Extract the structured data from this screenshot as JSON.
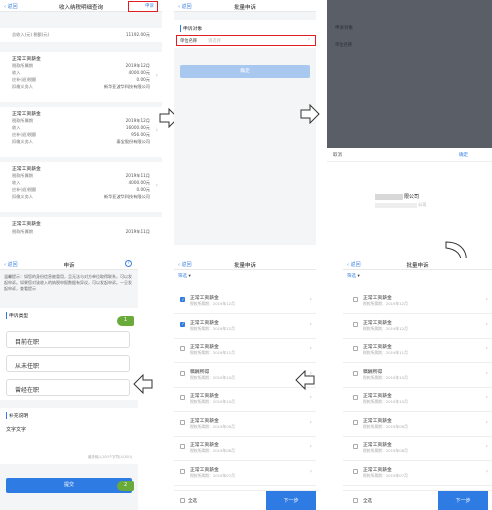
{
  "p1": {
    "back": "返回",
    "title": "收入纳税明细查询",
    "top_link": "申诉",
    "summary_k": "总收入(元) 税额(元)",
    "summary_v": "11192.00元",
    "records": [
      {
        "type": "正常工资薪金",
        "period_k": "税款所属期",
        "period_v": "2019年12月",
        "income_k": "收入",
        "income_v": "4000.00元",
        "tax_k": "应补(退)税额",
        "tax_v": "0.00元",
        "payer_k": "扣缴义务人",
        "payer_v": "新华亚波华科技有限公司"
      },
      {
        "type": "正常工资薪金",
        "period_k": "税款所属期",
        "period_v": "2019年12月",
        "income_k": "收入",
        "income_v": "16000.00元",
        "tax_k": "应补(退)税额",
        "tax_v": "956.00元",
        "payer_k": "扣缴义务人",
        "payer_v": "泰宝股份有限公司"
      },
      {
        "type": "正常工资薪金",
        "period_k": "税款所属期",
        "period_v": "2019年11月",
        "income_k": "收入",
        "income_v": "4000.00元",
        "tax_k": "应补(退)税额",
        "tax_v": "0.00元",
        "payer_k": "扣缴义务人",
        "payer_v": "新华亚波华科技有限公司"
      },
      {
        "type": "正常工资薪金",
        "period_k": "税款所属期",
        "period_v": "2019年11月"
      }
    ]
  },
  "p2": {
    "back": "返回",
    "title": "批量申诉",
    "section": "申诉对象",
    "field_k": "单位名称",
    "field_v": "请选择",
    "button": "确定"
  },
  "p3": {
    "section": "申诉对象",
    "field_k": "单位名称",
    "cancel": "取消",
    "confirm": "确定",
    "company": "限公司",
    "company_sub": "公司"
  },
  "p4": {
    "back": "返回",
    "title": "申诉",
    "help": "?",
    "notice": "温馨提示：如您的身份信息被冒用，且无法与对方单位取得联系，可以发起申诉。如果您对该收入的纳税申报数据有异议，可以发起申诉。一旦发起申诉，查看提示",
    "notice_link": "查看提示",
    "section_type": "申诉类型",
    "options": [
      "目前在职",
      "从未任职",
      "曾经在职"
    ],
    "section_extra": "补充说明",
    "extra_value": "文字文字",
    "counter": "最多输入200个字符(4/200)",
    "submit": "提交",
    "step1": "1",
    "step2": "2"
  },
  "p5": {
    "back": "返回",
    "title": "批量申诉",
    "filter": "筛选",
    "items": [
      {
        "t": "正常工资薪金",
        "s": "税款所属期：2019年12月",
        "on": true
      },
      {
        "t": "正常工资薪金",
        "s": "税款所属期：2019年12月",
        "on": true
      },
      {
        "t": "正常工资薪金",
        "s": "税款所属期：2019年11月",
        "on": false
      },
      {
        "t": "稿酬所得",
        "s": "税款所属期：2019年10月",
        "on": false
      },
      {
        "t": "正常工资薪金",
        "s": "税款所属期：2019年10月",
        "on": false
      },
      {
        "t": "正常工资薪金",
        "s": "税款所属期：2019年09月",
        "on": false
      },
      {
        "t": "正常工资薪金",
        "s": "税款所属期：2019年08月",
        "on": false
      },
      {
        "t": "正常工资薪金",
        "s": "税款所属期：2019年07月",
        "on": false
      }
    ],
    "select_all": "全选",
    "next": "下一步"
  },
  "p6": {
    "back": "返回",
    "title": "批量申诉",
    "filter": "筛选",
    "items": [
      {
        "t": "正常工资薪金",
        "s": "税款所属期：2019年12月"
      },
      {
        "t": "正常工资薪金",
        "s": "税款所属期：2019年12月"
      },
      {
        "t": "正常工资薪金",
        "s": "税款所属期：2019年11月"
      },
      {
        "t": "稿酬所得",
        "s": "税款所属期：2019年10月"
      },
      {
        "t": "正常工资薪金",
        "s": "税款所属期：2019年10月"
      },
      {
        "t": "正常工资薪金",
        "s": "税款所属期：2019年09月"
      },
      {
        "t": "正常工资薪金",
        "s": "税款所属期：2019年08月"
      },
      {
        "t": "正常工资薪金",
        "s": "税款所属期：2019年07月"
      }
    ],
    "select_all": "全选",
    "next": "下一步"
  },
  "colors": {
    "accent": "#2f7be4",
    "highlight": "#e02020",
    "step_badge": "#6aaa3a",
    "dim_overlay": "#5a5e66"
  }
}
